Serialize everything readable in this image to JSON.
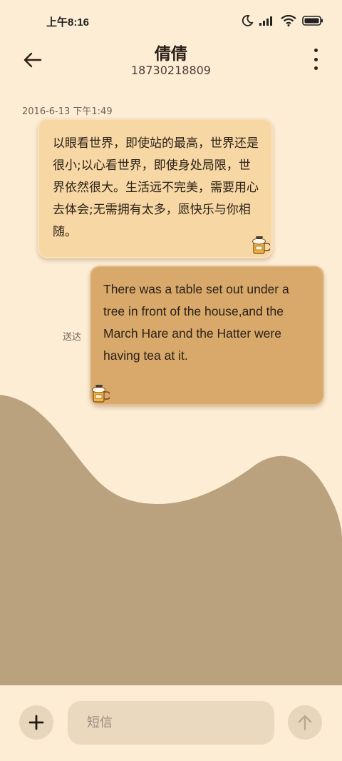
{
  "status_bar": {
    "time": "上午8:16",
    "icons": [
      "moon-icon",
      "signal-icon",
      "wifi-icon",
      "battery-icon"
    ]
  },
  "header": {
    "contact_name": "倩倩",
    "phone_number": "18730218809",
    "back_icon": "arrow-left-icon",
    "more_icon": "more-vertical-icon"
  },
  "conversation": {
    "timestamp": "2016-6-13 下午1:49",
    "messages": [
      {
        "direction": "incoming",
        "text": "以眼看世界，即使站的最高，世界还是很小;以心看世界，即使身处局限，世界依然很大。生活远不完美，需要用心去体会;无需拥有太多，愿快乐与你相随。",
        "sticker": "beer-mug-sticker"
      },
      {
        "direction": "outgoing",
        "text": "There was a table set out under a tree in front of the house,and the March Hare and the Hatter were having tea at it.",
        "status": "送达",
        "sticker": "beer-mug-sticker"
      }
    ]
  },
  "composer": {
    "placeholder": "短信",
    "add_icon": "plus-icon",
    "send_icon": "arrow-up-icon"
  },
  "colors": {
    "background": "#fdedd5",
    "incoming_bubble": "#f7d7a3",
    "outgoing_bubble": "#d8a96a",
    "hills": "#bba27e",
    "input": "#ebd9bf"
  }
}
